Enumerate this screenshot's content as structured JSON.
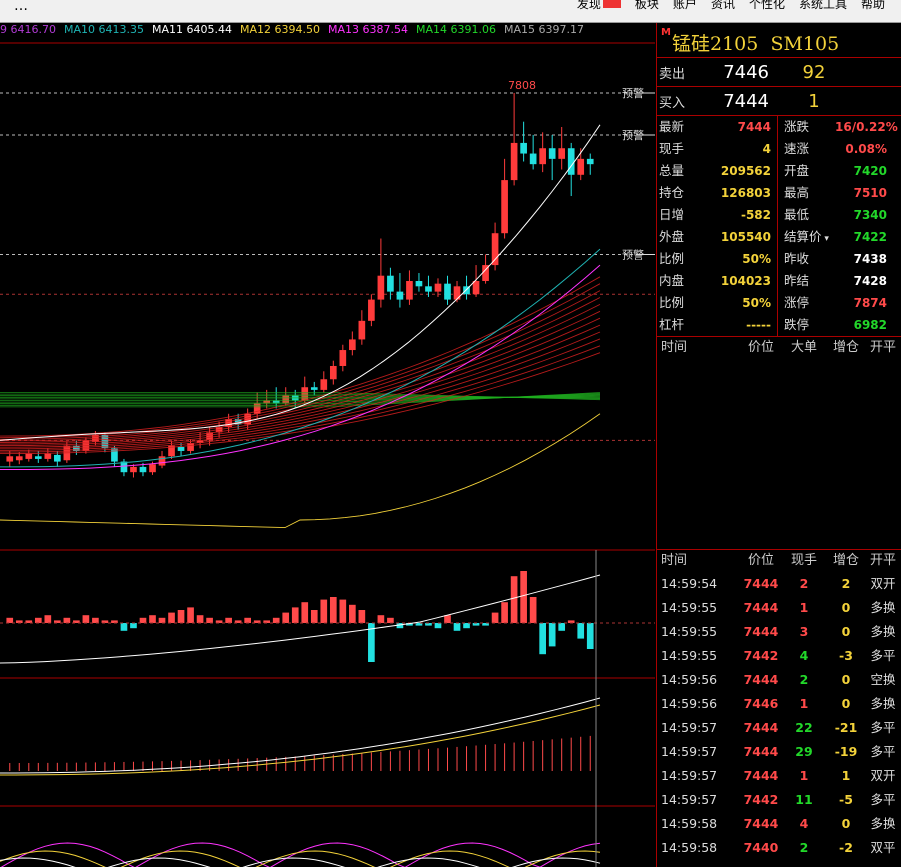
{
  "menubar": {
    "left": "…",
    "items": [
      "发现",
      "板块",
      "账户",
      "资讯",
      "个性化",
      "系统工具",
      "帮助"
    ]
  },
  "ma_legend": [
    {
      "label": "9 6416.70",
      "color": "#b23bd6"
    },
    {
      "label": "MA10 6413.35",
      "color": "#1fb3b3"
    },
    {
      "label": "MA11 6405.44",
      "color": "#ffffff"
    },
    {
      "label": "MA12 6394.50",
      "color": "#f3d23a"
    },
    {
      "label": "MA13 6387.54",
      "color": "#ff33ff"
    },
    {
      "label": "MA14 6391.06",
      "color": "#22d82a"
    },
    {
      "label": "MA15 6397.17",
      "color": "#aaaaaa"
    }
  ],
  "chart_labels": {
    "high": "7808",
    "alerts": [
      "预警",
      "预警",
      "预警"
    ]
  },
  "quote": {
    "marker": "M",
    "name": "锰硅2105",
    "code": "SM105",
    "sell": {
      "label": "卖出",
      "price": "7446",
      "vol": "92"
    },
    "buy": {
      "label": "买入",
      "price": "7444",
      "vol": "1"
    },
    "stats": [
      {
        "k": "最新",
        "v": "7444",
        "vc": "red",
        "k2": "涨跌",
        "v2": "16/0.22%",
        "v2c": "red"
      },
      {
        "k": "现手",
        "v": "4",
        "vc": "yellow",
        "k2": "速涨",
        "v2": "0.08%",
        "v2c": "red"
      },
      {
        "k": "总量",
        "v": "209562",
        "vc": "yellow",
        "k2": "开盘",
        "v2": "7420",
        "v2c": "green"
      },
      {
        "k": "持仓",
        "v": "126803",
        "vc": "yellow",
        "k2": "最高",
        "v2": "7510",
        "v2c": "red"
      },
      {
        "k": "日增",
        "v": "-582",
        "vc": "yellow",
        "k2": "最低",
        "v2": "7340",
        "v2c": "green"
      },
      {
        "k": "外盘",
        "v": "105540",
        "vc": "yellow",
        "k2": "结算价",
        "v2": "7422",
        "v2c": "green"
      },
      {
        "k": "比例",
        "v": "50%",
        "vc": "yellow",
        "k2": "昨收",
        "v2": "7438",
        "v2c": "white"
      },
      {
        "k": "内盘",
        "v": "104023",
        "vc": "yellow",
        "k2": "昨结",
        "v2": "7428",
        "v2c": "white"
      },
      {
        "k": "比例",
        "v": "50%",
        "vc": "yellow",
        "k2": "涨停",
        "v2": "7874",
        "v2c": "red"
      },
      {
        "k": "杠杆",
        "v": "-----",
        "vc": "yellow",
        "k2": "跌停",
        "v2": "6982",
        "v2c": "green"
      }
    ]
  },
  "bigorder_header": [
    "时间",
    "价位",
    "大单",
    "增仓",
    "开平"
  ],
  "tick_header": [
    "时间",
    "价位",
    "现手",
    "增仓",
    "开平"
  ],
  "ticks": [
    {
      "t": "14:59:54",
      "p": "7444",
      "q": "2",
      "d": "2",
      "k": "双开",
      "qc": "red",
      "dc": "yellow"
    },
    {
      "t": "14:59:55",
      "p": "7444",
      "q": "1",
      "d": "0",
      "k": "多换",
      "qc": "red",
      "dc": "yellow"
    },
    {
      "t": "14:59:55",
      "p": "7444",
      "q": "3",
      "d": "0",
      "k": "多换",
      "qc": "red",
      "dc": "yellow"
    },
    {
      "t": "14:59:55",
      "p": "7442",
      "q": "4",
      "d": "-3",
      "k": "多平",
      "qc": "green",
      "dc": "yellow"
    },
    {
      "t": "14:59:56",
      "p": "7444",
      "q": "2",
      "d": "0",
      "k": "空换",
      "qc": "green",
      "dc": "yellow"
    },
    {
      "t": "14:59:56",
      "p": "7446",
      "q": "1",
      "d": "0",
      "k": "多换",
      "qc": "red",
      "dc": "yellow"
    },
    {
      "t": "14:59:57",
      "p": "7444",
      "q": "22",
      "d": "-21",
      "k": "多平",
      "qc": "green",
      "dc": "yellow"
    },
    {
      "t": "14:59:57",
      "p": "7444",
      "q": "29",
      "d": "-19",
      "k": "多平",
      "qc": "green",
      "dc": "yellow"
    },
    {
      "t": "14:59:57",
      "p": "7444",
      "q": "1",
      "d": "1",
      "k": "双开",
      "qc": "red",
      "dc": "yellow"
    },
    {
      "t": "14:59:57",
      "p": "7442",
      "q": "11",
      "d": "-5",
      "k": "多平",
      "qc": "green",
      "dc": "yellow"
    },
    {
      "t": "14:59:58",
      "p": "7444",
      "q": "4",
      "d": "0",
      "k": "多换",
      "qc": "red",
      "dc": "yellow"
    },
    {
      "t": "14:59:58",
      "p": "7440",
      "q": "2",
      "d": "-2",
      "k": "双平",
      "qc": "green",
      "dc": "yellow"
    }
  ],
  "colors": {
    "up": "#ff3b3b",
    "down": "#22e0e0",
    "border": "#aa0000"
  }
}
